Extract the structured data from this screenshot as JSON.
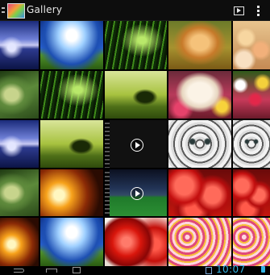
{
  "actionbar": {
    "title": "Gallery",
    "icons": [
      "up-caret-icon",
      "gallery-app-icon",
      "slideshow-icon",
      "overflow-menu-icon"
    ]
  },
  "grid": {
    "tiles": [
      {
        "name": "photo-lake",
        "style": "lake"
      },
      {
        "name": "photo-sky-field",
        "style": "sky-field"
      },
      {
        "name": "photo-grass",
        "style": "grass"
      },
      {
        "name": "photo-kitten",
        "style": "kitten"
      },
      {
        "name": "photo-eggs",
        "style": "eggs"
      },
      {
        "name": "photo-leaf",
        "style": "leaf"
      },
      {
        "name": "photo-grass",
        "style": "grass"
      },
      {
        "name": "photo-tree",
        "style": "tree"
      },
      {
        "name": "photo-dog",
        "style": "dog"
      },
      {
        "name": "photo-flowers",
        "style": "flowers-mix"
      },
      {
        "name": "photo-lake",
        "style": "lake"
      },
      {
        "name": "photo-tree",
        "style": "tree"
      },
      {
        "name": "video-thumbnail",
        "style": "video-dark",
        "video": true
      },
      {
        "name": "photo-snow-leopard",
        "style": "tiger"
      },
      {
        "name": "photo-snow-leopard",
        "style": "tiger"
      },
      {
        "name": "photo-leaf",
        "style": "leaf"
      },
      {
        "name": "photo-sunburst",
        "style": "sunburst"
      },
      {
        "name": "video-thumbnail-stadium",
        "style": "stadium",
        "video": true
      },
      {
        "name": "photo-tomatoes",
        "style": "tomato"
      },
      {
        "name": "photo-tomatoes",
        "style": "tomato"
      },
      {
        "name": "photo-sunburst",
        "style": "sunburst"
      },
      {
        "name": "photo-sky-field",
        "style": "sky-field"
      },
      {
        "name": "photo-apples",
        "style": "apple"
      },
      {
        "name": "photo-roses",
        "style": "roses"
      },
      {
        "name": "photo-roses",
        "style": "roses"
      }
    ]
  },
  "statusbar": {
    "time": "10:07",
    "icons": [
      "back-icon",
      "home-icon",
      "recent-apps-icon",
      "screenshot-icon",
      "battery-icon"
    ]
  }
}
